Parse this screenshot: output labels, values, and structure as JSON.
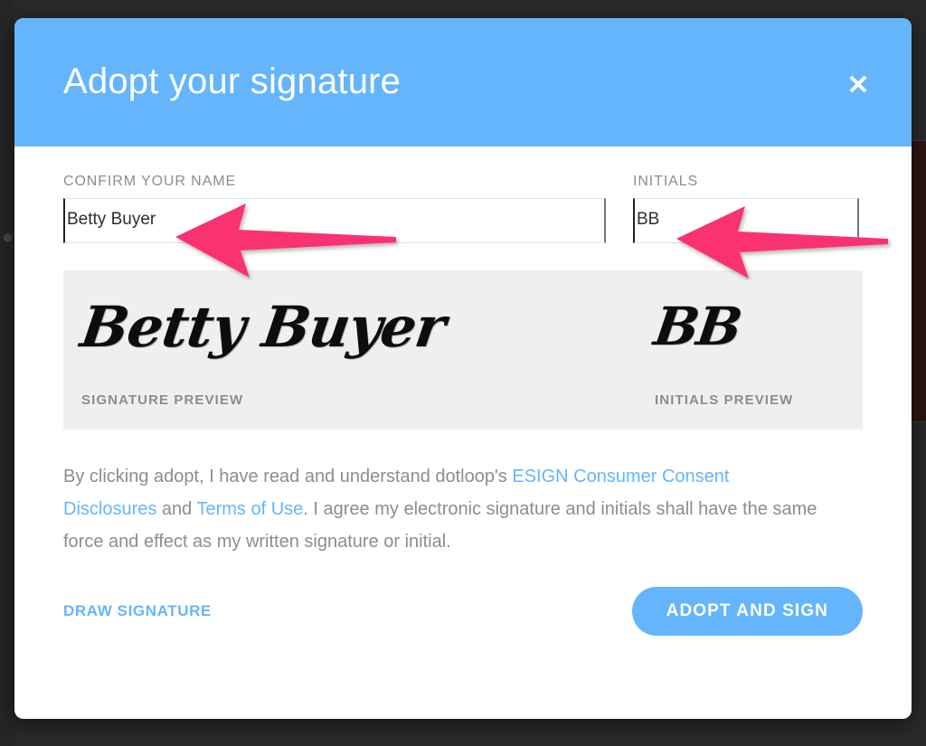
{
  "modal": {
    "title": "Adopt your signature",
    "close_icon": "close-icon",
    "header_color": "#64b5fc"
  },
  "fields": {
    "name": {
      "label": "CONFIRM YOUR NAME",
      "value": "Betty Buyer",
      "placeholder": "Confirm your name"
    },
    "initials": {
      "label": "INITIALS",
      "value": "BB",
      "placeholder": "Initials"
    }
  },
  "preview": {
    "signature_text": "Betty Buyer",
    "signature_caption": "SIGNATURE PREVIEW",
    "initials_text": "BB",
    "initials_caption": "INITIALS PREVIEW",
    "panel_color": "#efefef"
  },
  "disclosure": {
    "part1": "By clicking adopt, I have read and understand dotloop's ",
    "link1": "ESIGN Consumer Consent Disclosures",
    "part2": " and ",
    "link2": "Terms of Use",
    "part3": ". I agree my electronic signature and initials shall have the same force and effect as my written signature or initial.",
    "link_color": "#64b5fc"
  },
  "footer": {
    "draw_label": "DRAW SIGNATURE",
    "adopt_label": "ADOPT AND SIGN",
    "adopt_color": "#64b5fc"
  },
  "annotations": {
    "arrow_color": "#fa3370",
    "arrow_name_target": "confirm-your-name-field",
    "arrow_initials_target": "initials-field"
  }
}
